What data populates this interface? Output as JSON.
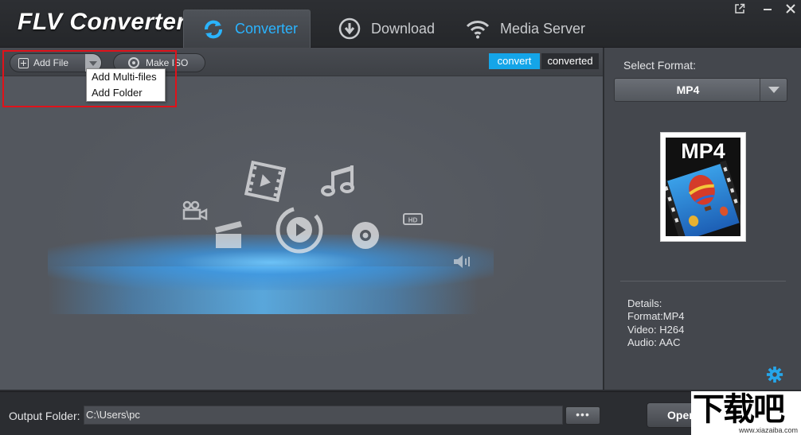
{
  "app": {
    "title": "FLV Converter"
  },
  "tabs": [
    {
      "label": "Converter",
      "icon": "refresh-icon",
      "active": true
    },
    {
      "label": "Download",
      "icon": "download-icon",
      "active": false
    },
    {
      "label": "Media Server",
      "icon": "wifi-icon",
      "active": false
    }
  ],
  "window_controls": [
    "popout-icon",
    "minimize-icon",
    "close-icon"
  ],
  "toolbar": {
    "add_file": "Add File",
    "make_iso": "Make ISO",
    "convert_tab": "convert",
    "converted_tab": "converted"
  },
  "add_file_menu": {
    "items": [
      "Add Multi-files",
      "Add Folder"
    ]
  },
  "right_panel": {
    "select_format_label": "Select Format:",
    "format_value": "MP4",
    "thumbnail_text": "MP4",
    "details": {
      "title": "Details:",
      "format": "Format:MP4",
      "video": "Video: H264",
      "audio": "Audio: AAC"
    }
  },
  "bottom": {
    "output_label": "Output Folder:",
    "output_path": "C:\\Users\\pc",
    "browse_label": "•••",
    "open_label": "Open"
  },
  "watermark": {
    "text": "下载吧",
    "url": "www.xiazaiba.com"
  },
  "colors": {
    "accent": "#14a5e8",
    "active_tab_text": "#2ab4ff",
    "highlight": "#e0121a"
  }
}
